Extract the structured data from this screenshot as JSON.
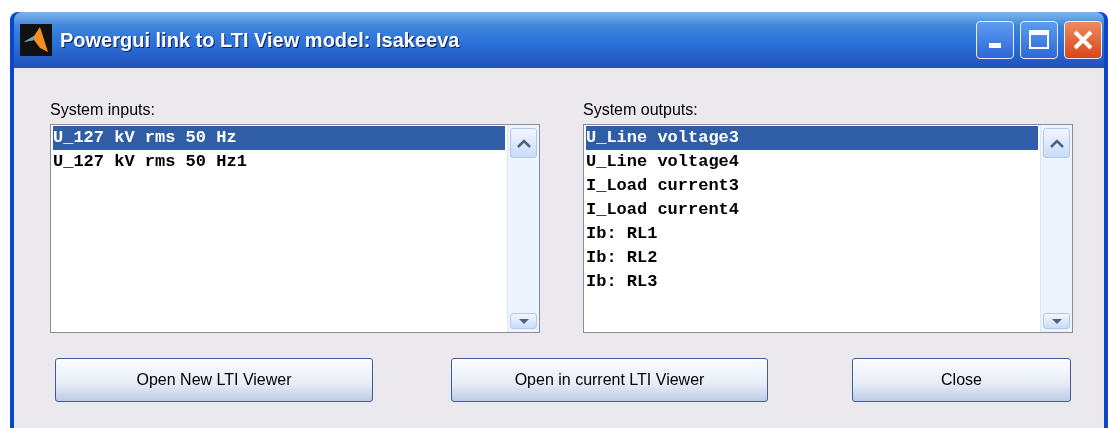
{
  "window": {
    "title": "Powergui link to LTI View model: Isakeeva"
  },
  "inputs": {
    "label": "System inputs:",
    "items": [
      {
        "text": "U_127 kV rms 50 Hz",
        "selected": true
      },
      {
        "text": "U_127 kV rms 50 Hz1",
        "selected": false
      }
    ]
  },
  "outputs": {
    "label": "System outputs:",
    "items": [
      {
        "text": "U_Line voltage3",
        "selected": true
      },
      {
        "text": "U_Line voltage4",
        "selected": false
      },
      {
        "text": "I_Load current3",
        "selected": false
      },
      {
        "text": "I_Load current4",
        "selected": false
      },
      {
        "text": "Ib: RL1",
        "selected": false
      },
      {
        "text": "Ib: RL2",
        "selected": false
      },
      {
        "text": "Ib: RL3",
        "selected": false
      }
    ]
  },
  "buttons": [
    "Open New LTI Viewer",
    "Open in current LTI Viewer",
    "Close"
  ]
}
